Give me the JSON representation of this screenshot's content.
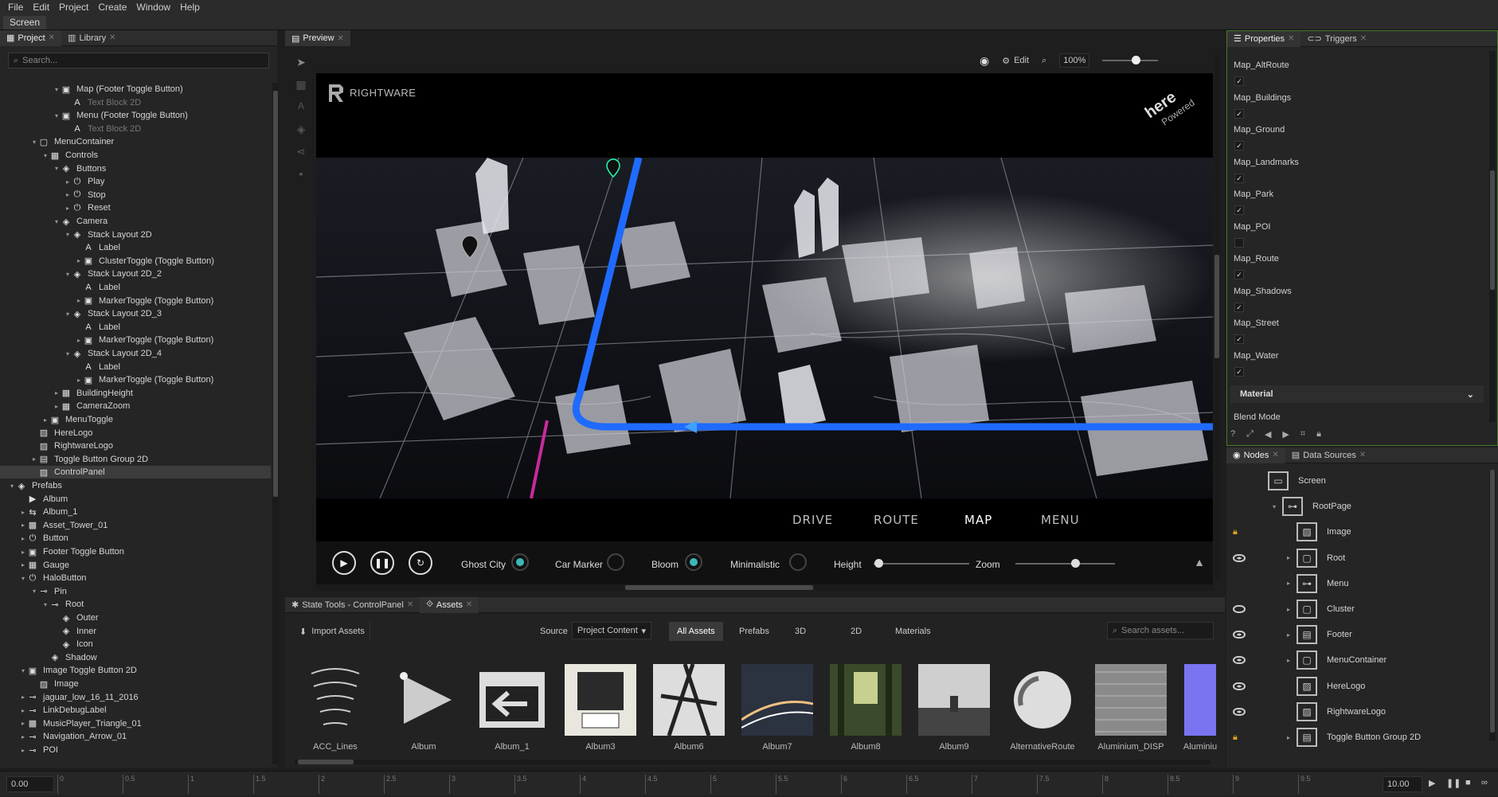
{
  "menu": {
    "items": [
      "File",
      "Edit",
      "Project",
      "Create",
      "Window",
      "Help"
    ]
  },
  "screen_tab": "Screen",
  "left_tabs": [
    "Project",
    "Library"
  ],
  "search_placeholder": "Search...",
  "tree": [
    {
      "label": "Map (Footer Toggle Button)",
      "depth": 5,
      "arrow": "▾",
      "icon": "toggle"
    },
    {
      "label": "Text Block 2D",
      "depth": 6,
      "arrow": "",
      "icon": "text",
      "dim": true
    },
    {
      "label": "Menu (Footer Toggle Button)",
      "depth": 5,
      "arrow": "▾",
      "icon": "toggle"
    },
    {
      "label": "Text Block 2D",
      "depth": 6,
      "arrow": "",
      "icon": "text",
      "dim": true
    },
    {
      "label": "MenuContainer",
      "depth": 3,
      "arrow": "▾",
      "icon": "box"
    },
    {
      "label": "Controls",
      "depth": 4,
      "arrow": "▾",
      "icon": "grid"
    },
    {
      "label": "Buttons",
      "depth": 5,
      "arrow": "▾",
      "icon": "stack"
    },
    {
      "label": "Play",
      "depth": 6,
      "arrow": "▸",
      "icon": "power"
    },
    {
      "label": "Stop",
      "depth": 6,
      "arrow": "▸",
      "icon": "power"
    },
    {
      "label": "Reset",
      "depth": 6,
      "arrow": "▸",
      "icon": "power"
    },
    {
      "label": "Camera",
      "depth": 5,
      "arrow": "▾",
      "icon": "stack"
    },
    {
      "label": "Stack Layout 2D",
      "depth": 6,
      "arrow": "▾",
      "icon": "stack"
    },
    {
      "label": "Label",
      "depth": 7,
      "arrow": "",
      "icon": "text"
    },
    {
      "label": "ClusterToggle (Toggle Button)",
      "depth": 7,
      "arrow": "▸",
      "icon": "toggle"
    },
    {
      "label": "Stack Layout 2D_2",
      "depth": 6,
      "arrow": "▾",
      "icon": "stack"
    },
    {
      "label": "Label",
      "depth": 7,
      "arrow": "",
      "icon": "text"
    },
    {
      "label": "MarkerToggle (Toggle Button)",
      "depth": 7,
      "arrow": "▸",
      "icon": "toggle"
    },
    {
      "label": "Stack Layout 2D_3",
      "depth": 6,
      "arrow": "▾",
      "icon": "stack"
    },
    {
      "label": "Label",
      "depth": 7,
      "arrow": "",
      "icon": "text"
    },
    {
      "label": "MarkerToggle (Toggle Button)",
      "depth": 7,
      "arrow": "▸",
      "icon": "toggle"
    },
    {
      "label": "Stack Layout 2D_4",
      "depth": 6,
      "arrow": "▾",
      "icon": "stack"
    },
    {
      "label": "Label",
      "depth": 7,
      "arrow": "",
      "icon": "text"
    },
    {
      "label": "MarkerToggle (Toggle Button)",
      "depth": 7,
      "arrow": "▸",
      "icon": "toggle"
    },
    {
      "label": "BuildingHeight",
      "depth": 5,
      "arrow": "▸",
      "icon": "grid"
    },
    {
      "label": "CameraZoom",
      "depth": 5,
      "arrow": "▸",
      "icon": "grid"
    },
    {
      "label": "MenuToggle",
      "depth": 4,
      "arrow": "▸",
      "icon": "toggle"
    },
    {
      "label": "HereLogo",
      "depth": 3,
      "arrow": "",
      "icon": "image"
    },
    {
      "label": "RightwareLogo",
      "depth": 3,
      "arrow": "",
      "icon": "image"
    },
    {
      "label": "Toggle Button Group 2D",
      "depth": 3,
      "arrow": "▸",
      "icon": "group"
    },
    {
      "label": "ControlPanel",
      "depth": 3,
      "arrow": "",
      "icon": "image",
      "selected": true
    },
    {
      "label": "Prefabs",
      "depth": 1,
      "arrow": "▾",
      "icon": "stack"
    },
    {
      "label": "Album",
      "depth": 2,
      "arrow": "",
      "icon": "album"
    },
    {
      "label": "Album_1",
      "depth": 2,
      "arrow": "▸",
      "icon": "album1"
    },
    {
      "label": "Asset_Tower_01",
      "depth": 2,
      "arrow": "▸",
      "icon": "film"
    },
    {
      "label": "Button",
      "depth": 2,
      "arrow": "▸",
      "icon": "power"
    },
    {
      "label": "Footer Toggle Button",
      "depth": 2,
      "arrow": "▸",
      "icon": "toggle"
    },
    {
      "label": "Gauge",
      "depth": 2,
      "arrow": "▸",
      "icon": "grid"
    },
    {
      "label": "HaloButton",
      "depth": 2,
      "arrow": "▾",
      "icon": "power"
    },
    {
      "label": "Pin",
      "depth": 3,
      "arrow": "▾",
      "icon": "pin"
    },
    {
      "label": "Root",
      "depth": 4,
      "arrow": "▾",
      "icon": "pin"
    },
    {
      "label": "Outer",
      "depth": 5,
      "arrow": "",
      "icon": "stack"
    },
    {
      "label": "Inner",
      "depth": 5,
      "arrow": "",
      "icon": "stack"
    },
    {
      "label": "Icon",
      "depth": 5,
      "arrow": "",
      "icon": "stack"
    },
    {
      "label": "Shadow",
      "depth": 4,
      "arrow": "",
      "icon": "stack"
    },
    {
      "label": "Image Toggle Button 2D",
      "depth": 2,
      "arrow": "▾",
      "icon": "toggle"
    },
    {
      "label": "Image",
      "depth": 3,
      "arrow": "",
      "icon": "image"
    },
    {
      "label": "jaguar_low_16_11_2016",
      "depth": 2,
      "arrow": "▸",
      "icon": "pin"
    },
    {
      "label": "LinkDebugLabel",
      "depth": 2,
      "arrow": "▸",
      "icon": "pin"
    },
    {
      "label": "MusicPlayer_Triangle_01",
      "depth": 2,
      "arrow": "▸",
      "icon": "film"
    },
    {
      "label": "Navigation_Arrow_01",
      "depth": 2,
      "arrow": "▸",
      "icon": "pin"
    },
    {
      "label": "POI",
      "depth": 2,
      "arrow": "▸",
      "icon": "pin"
    }
  ],
  "preview": {
    "tab": "Preview",
    "edit_label": "Edit",
    "zoom": "100%",
    "zoom_level": 0.6,
    "logo_text": "RIGHTWARE",
    "here_text": "here",
    "powered_text": "Powered",
    "nav": [
      "DRIVE",
      "ROUTE",
      "MAP",
      "MENU"
    ],
    "nav_active": "MAP",
    "controls": {
      "toggles": [
        {
          "label": "Ghost City",
          "on": true
        },
        {
          "label": "Car Marker",
          "on": false
        },
        {
          "label": "Bloom",
          "on": true
        },
        {
          "label": "Minimalistic",
          "on": false
        }
      ],
      "height_label": "Height",
      "height_value": 0.05,
      "zoom_label": "Zoom",
      "zoom_value": 0.6
    }
  },
  "bottom_tabs": [
    "State Tools - ControlPanel",
    "Assets"
  ],
  "assets": {
    "import_label": "Import Assets",
    "source_label": "Source",
    "source_value": "Project Content",
    "filters": [
      "All Assets",
      "Prefabs",
      "3D",
      "2D",
      "Materials"
    ],
    "active_filter": "All Assets",
    "search_placeholder": "Search assets...",
    "items": [
      {
        "name": "ACC_Lines",
        "kind": "lines"
      },
      {
        "name": "Album",
        "kind": "album"
      },
      {
        "name": "Album_1",
        "kind": "album1"
      },
      {
        "name": "Album3",
        "kind": "typewriter"
      },
      {
        "name": "Album6",
        "kind": "bridge"
      },
      {
        "name": "Album7",
        "kind": "road"
      },
      {
        "name": "Album8",
        "kind": "forest"
      },
      {
        "name": "Album9",
        "kind": "fog"
      },
      {
        "name": "AlternativeRoute",
        "kind": "circle"
      },
      {
        "name": "Aluminium_DISP",
        "kind": "metal"
      },
      {
        "name": "Aluminiu",
        "kind": "purple"
      }
    ]
  },
  "right_tabs": [
    "Properties",
    "Triggers"
  ],
  "properties": [
    {
      "label": "Map_AltRoute",
      "checked": true
    },
    {
      "label": "Map_Buildings",
      "checked": true
    },
    {
      "label": "Map_Ground",
      "checked": true
    },
    {
      "label": "Map_Landmarks",
      "checked": true
    },
    {
      "label": "Map_Park",
      "checked": true
    },
    {
      "label": "Map_POI",
      "checked": false
    },
    {
      "label": "Map_Route",
      "checked": true
    },
    {
      "label": "Map_Shadows",
      "checked": true
    },
    {
      "label": "Map_Street",
      "checked": true
    },
    {
      "label": "Map_Water",
      "checked": true
    }
  ],
  "material_section": "Material",
  "blend_mode_label": "Blend Mode",
  "nodes_tabs": [
    "Nodes",
    "Data Sources"
  ],
  "nodes": [
    {
      "label": "Screen",
      "indent": 0,
      "icon": "monitor",
      "eye": "none",
      "arrow": ""
    },
    {
      "label": "RootPage",
      "indent": 1,
      "icon": "tree",
      "eye": "none",
      "arrow": "▾"
    },
    {
      "label": "Image",
      "indent": 2,
      "icon": "image",
      "eye": "lock",
      "arrow": ""
    },
    {
      "label": "Root",
      "indent": 2,
      "icon": "box",
      "eye": "on",
      "arrow": "▸"
    },
    {
      "label": "Menu",
      "indent": 2,
      "icon": "tree",
      "eye": "none",
      "arrow": "▸"
    },
    {
      "label": "Cluster",
      "indent": 2,
      "icon": "box",
      "eye": "off",
      "arrow": "▸"
    },
    {
      "label": "Footer",
      "indent": 2,
      "icon": "grid",
      "eye": "on",
      "arrow": "▸"
    },
    {
      "label": "MenuContainer",
      "indent": 2,
      "icon": "box",
      "eye": "on",
      "arrow": "▸"
    },
    {
      "label": "HereLogo",
      "indent": 2,
      "icon": "image",
      "eye": "on",
      "arrow": ""
    },
    {
      "label": "RightwareLogo",
      "indent": 2,
      "icon": "image",
      "eye": "on",
      "arrow": ""
    },
    {
      "label": "Toggle Button Group 2D",
      "indent": 2,
      "icon": "grid",
      "eye": "lock",
      "arrow": "▸"
    }
  ],
  "timeline": {
    "start": "0.00",
    "end": "10.00",
    "ticks": [
      "0",
      "0.5",
      "1",
      "1.5",
      "2",
      "2.5",
      "3",
      "3.5",
      "4",
      "4.5",
      "5",
      "5.5",
      "6",
      "6.5",
      "7",
      "7.5",
      "8",
      "8.5",
      "9",
      "9.5"
    ]
  },
  "colors": {
    "accent": "#2a7fff",
    "toggle_on": "#3ab8b8",
    "route": "#1f6bff",
    "selection": "#3c3c3c"
  }
}
